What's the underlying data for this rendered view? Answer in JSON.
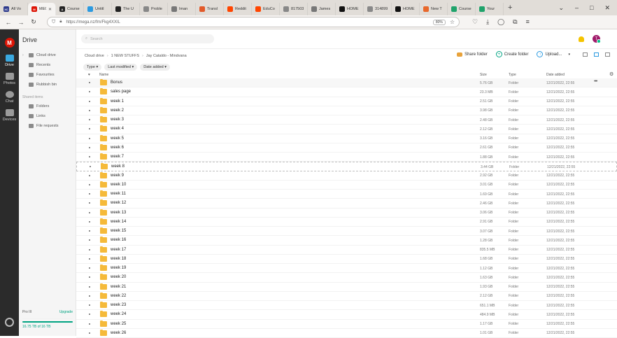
{
  "browser": {
    "tabs": [
      {
        "label": "All Vo",
        "color": "#2d3a8c",
        "glyph": "XC"
      },
      {
        "label": "MEGA",
        "color": "#dd1405",
        "glyph": "M",
        "active": true
      },
      {
        "label": "Course",
        "color": "#222222",
        "glyph": "A"
      },
      {
        "label": "Untitl",
        "color": "#2b9ae0",
        "glyph": ""
      },
      {
        "label": "The U",
        "color": "#222222",
        "glyph": ""
      },
      {
        "label": "Proble",
        "color": "#888888",
        "glyph": ""
      },
      {
        "label": "Iman",
        "color": "#777777",
        "glyph": ""
      },
      {
        "label": "Transl",
        "color": "#e25a2a",
        "glyph": ""
      },
      {
        "label": "Reddit",
        "color": "#ff4500",
        "glyph": ""
      },
      {
        "label": "EduCo",
        "color": "#ff4500",
        "glyph": ""
      },
      {
        "label": "8175032_",
        "color": "#888888",
        "glyph": ""
      },
      {
        "label": "James",
        "color": "#777777",
        "glyph": ""
      },
      {
        "label": "HOME",
        "color": "#111111",
        "glyph": ""
      },
      {
        "label": "314899_60",
        "color": "#888888",
        "glyph": ""
      },
      {
        "label": "HOME",
        "color": "#111111",
        "glyph": ""
      },
      {
        "label": "New T",
        "color": "#e8682c",
        "glyph": ""
      },
      {
        "label": "Course",
        "color": "#1fa36b",
        "glyph": ""
      },
      {
        "label": "Your",
        "color": "#1fa36b",
        "glyph": ""
      }
    ],
    "new_tab": "+",
    "url": "https://mega.nz/fm/Fkg4XXIL",
    "zoom": "80%"
  },
  "rail": {
    "logo": "M",
    "items": [
      {
        "label": "Drive",
        "color": "#3aa9e0",
        "active": true
      },
      {
        "label": "Photos",
        "color": "#9a9a9a"
      },
      {
        "label": "Chat",
        "color": "#9a9a9a"
      },
      {
        "label": "Devices",
        "color": "#9a9a9a"
      }
    ]
  },
  "sidebar": {
    "title": "Drive",
    "items": [
      {
        "label": "Cloud drive"
      },
      {
        "label": "Recents"
      },
      {
        "label": "Favourites"
      },
      {
        "label": "Rubbish bin"
      }
    ],
    "shared_title": "Shared items",
    "shared": [
      {
        "label": "Folders"
      },
      {
        "label": "Links"
      },
      {
        "label": "File requests"
      }
    ],
    "storage": {
      "plan": "Pro III",
      "upgrade": "Upgrade",
      "used": "16.75 TB of 16 TB",
      "fill": 1.0
    }
  },
  "main": {
    "search_placeholder": "Search",
    "avatar": "T",
    "breadcrumb": [
      "Cloud drive",
      "1 NEW STUFFS",
      "Jay Cataldo - Mindvana"
    ],
    "actions": {
      "share": "Share folder",
      "create": "Create folder",
      "upload": "Upload..."
    },
    "filters": [
      "Type",
      "Last modified",
      "Date added"
    ],
    "columns": {
      "name": "Name",
      "size": "Size",
      "type": "Type",
      "date": "Date added"
    },
    "rows": [
      {
        "name": "Bonus",
        "size": "5.76 GB",
        "type": "Folder",
        "date": "12/21/2022, 22:55"
      },
      {
        "name": "sales page",
        "size": "23.3 MB",
        "type": "Folder",
        "date": "12/21/2022, 22:55"
      },
      {
        "name": "week 1",
        "size": "2.51 GB",
        "type": "Folder",
        "date": "12/21/2022, 22:55"
      },
      {
        "name": "week 2",
        "size": "3.98 GB",
        "type": "Folder",
        "date": "12/21/2022, 22:55"
      },
      {
        "name": "week 3",
        "size": "2.48 GB",
        "type": "Folder",
        "date": "12/21/2022, 22:55"
      },
      {
        "name": "week 4",
        "size": "2.12 GB",
        "type": "Folder",
        "date": "12/21/2022, 22:55"
      },
      {
        "name": "week 5",
        "size": "3.16 GB",
        "type": "Folder",
        "date": "12/21/2022, 22:55"
      },
      {
        "name": "week 6",
        "size": "2.61 GB",
        "type": "Folder",
        "date": "12/21/2022, 22:55"
      },
      {
        "name": "week 7",
        "size": "1.88 GB",
        "type": "Folder",
        "date": "12/21/2022, 22:55"
      },
      {
        "name": "week 8",
        "size": "3.44 GB",
        "type": "Folder",
        "date": "12/21/2022, 22:55"
      },
      {
        "name": "week 9",
        "size": "2.92 GB",
        "type": "Folder",
        "date": "12/21/2022, 22:55"
      },
      {
        "name": "week 10",
        "size": "3.01 GB",
        "type": "Folder",
        "date": "12/21/2022, 22:55"
      },
      {
        "name": "week 11",
        "size": "1.69 GB",
        "type": "Folder",
        "date": "12/21/2022, 22:55"
      },
      {
        "name": "week 12",
        "size": "2.46 GB",
        "type": "Folder",
        "date": "12/21/2022, 22:55"
      },
      {
        "name": "week 13",
        "size": "3.06 GB",
        "type": "Folder",
        "date": "12/21/2022, 22:55"
      },
      {
        "name": "week 14",
        "size": "2.91 GB",
        "type": "Folder",
        "date": "12/21/2022, 22:55"
      },
      {
        "name": "week 15",
        "size": "3.07 GB",
        "type": "Folder",
        "date": "12/21/2022, 22:55"
      },
      {
        "name": "week 16",
        "size": "1.28 GB",
        "type": "Folder",
        "date": "12/21/2022, 22:55"
      },
      {
        "name": "week 17",
        "size": "835.5 MB",
        "type": "Folder",
        "date": "12/21/2022, 22:55"
      },
      {
        "name": "week 18",
        "size": "1.68 GB",
        "type": "Folder",
        "date": "12/21/2022, 22:55"
      },
      {
        "name": "week 19",
        "size": "1.12 GB",
        "type": "Folder",
        "date": "12/21/2022, 22:55"
      },
      {
        "name": "week 20",
        "size": "1.63 GB",
        "type": "Folder",
        "date": "12/21/2022, 22:55"
      },
      {
        "name": "week 21",
        "size": "1.93 GB",
        "type": "Folder",
        "date": "12/21/2022, 22:55"
      },
      {
        "name": "week 22",
        "size": "2.12 GB",
        "type": "Folder",
        "date": "12/21/2022, 22:55"
      },
      {
        "name": "week 23",
        "size": "651.1 MB",
        "type": "Folder",
        "date": "12/21/2022, 22:55"
      },
      {
        "name": "week 24",
        "size": "484.9 MB",
        "type": "Folder",
        "date": "12/21/2022, 22:55"
      },
      {
        "name": "week 25",
        "size": "1.17 GB",
        "type": "Folder",
        "date": "12/21/2022, 22:55"
      },
      {
        "name": "week 26",
        "size": "1.01 GB",
        "type": "Folder",
        "date": "12/21/2022, 22:55"
      }
    ]
  }
}
